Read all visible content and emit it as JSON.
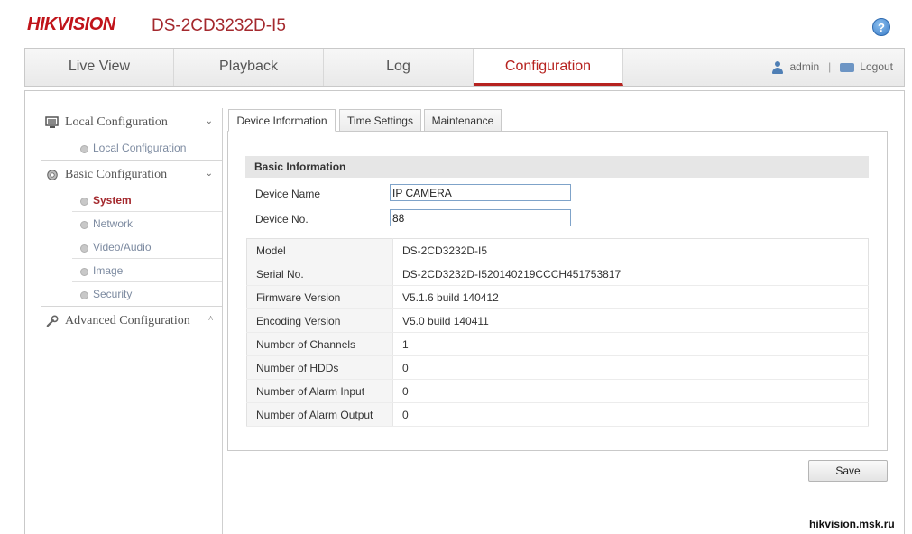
{
  "header": {
    "logo": "HIKVISION",
    "model": "DS-2CD3232D-I5",
    "help_icon": "question-icon"
  },
  "nav": {
    "tabs": [
      {
        "label": "Live View"
      },
      {
        "label": "Playback"
      },
      {
        "label": "Log"
      },
      {
        "label": "Configuration"
      }
    ],
    "active_tab": "Configuration",
    "user": "admin",
    "separator": "|",
    "logout": "Logout"
  },
  "sidebar": {
    "groups": [
      {
        "label": "Local Configuration",
        "icon": "monitor-icon",
        "chevron": "⌄",
        "items": [
          "Local Configuration"
        ]
      },
      {
        "label": "Basic Configuration",
        "icon": "gear-icon",
        "chevron": "⌄",
        "items": [
          "System",
          "Network",
          "Video/Audio",
          "Image",
          "Security"
        ]
      },
      {
        "label": "Advanced Configuration",
        "icon": "wrench-icon",
        "chevron": "^",
        "items": []
      }
    ],
    "active_item": "System"
  },
  "subtabs": [
    "Device Information",
    "Time Settings",
    "Maintenance"
  ],
  "active_subtab": "Device Information",
  "basic_info": {
    "title": "Basic Information",
    "device_name_label": "Device Name",
    "device_name_value": "IP CAMERA",
    "device_no_label": "Device No.",
    "device_no_value": "88"
  },
  "info_rows": [
    {
      "label": "Model",
      "value": "DS-2CD3232D-I5"
    },
    {
      "label": "Serial No.",
      "value": "DS-2CD3232D-I520140219CCCH451753817"
    },
    {
      "label": "Firmware Version",
      "value": "V5.1.6 build 140412"
    },
    {
      "label": "Encoding Version",
      "value": "V5.0 build 140411"
    },
    {
      "label": "Number of Channels",
      "value": "1"
    },
    {
      "label": "Number of HDDs",
      "value": "0"
    },
    {
      "label": "Number of Alarm Input",
      "value": "0"
    },
    {
      "label": "Number of Alarm Output",
      "value": "0"
    }
  ],
  "save_label": "Save",
  "watermark": "hikvision.msk.ru",
  "colors": {
    "brand_red": "#c0141a",
    "accent_red": "#a4292e",
    "link_gray_blue": "#7c8aa0"
  }
}
